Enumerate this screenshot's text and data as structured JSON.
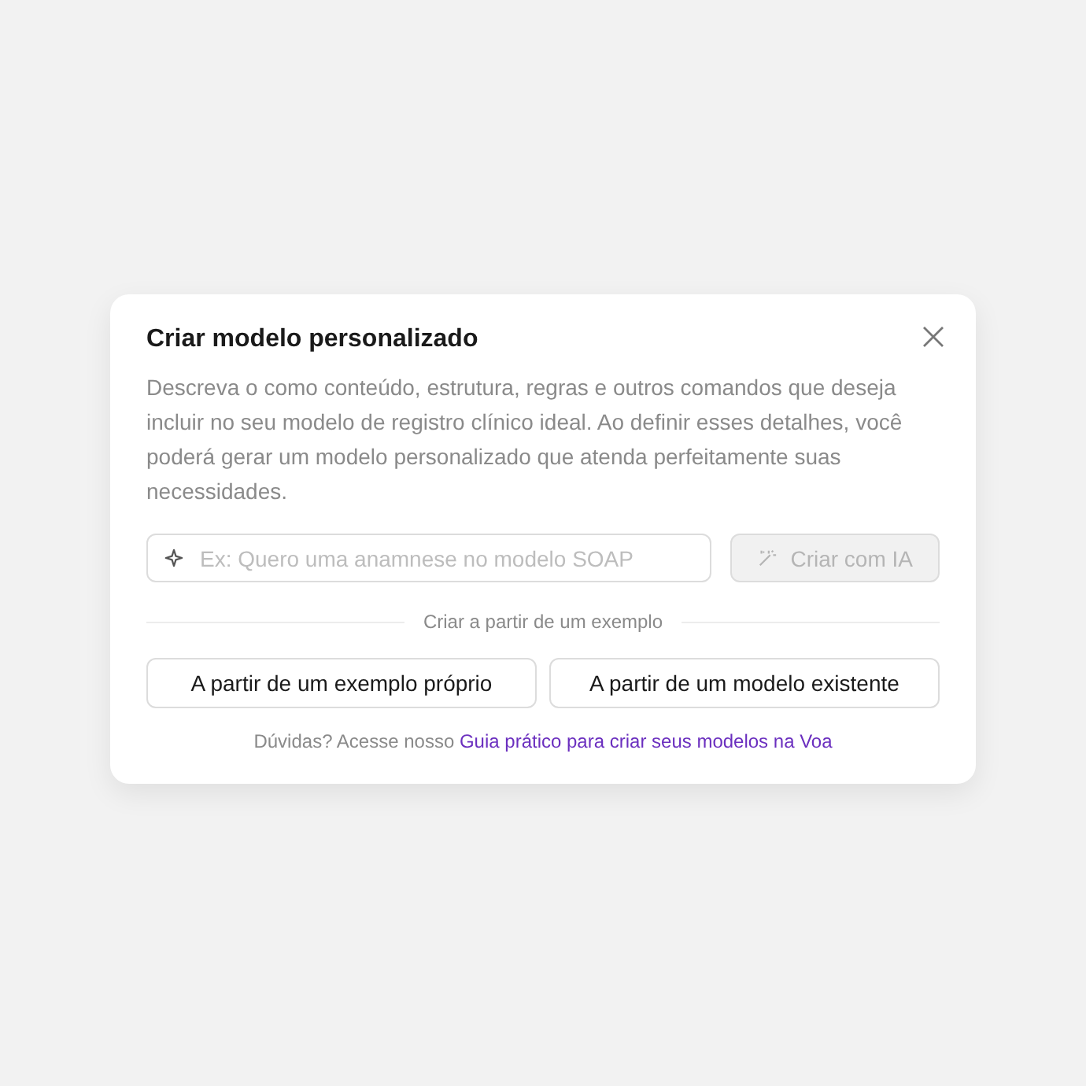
{
  "dialog": {
    "title": "Criar modelo personalizado",
    "description": "Descreva o como conteúdo, estrutura, regras e outros comandos que deseja incluir no seu modelo de registro clínico ideal. Ao definir esses detalhes, você poderá gerar um modelo personalizado que atenda perfeitamente suas necessidades.",
    "prompt_field": {
      "placeholder": "Ex: Quero uma anamnese no modelo SOAP"
    },
    "create_button": {
      "label": "Criar com IA",
      "disabled": true
    },
    "divider_label": "Criar a partir de um exemplo",
    "option_buttons": [
      "A partir de um exemplo próprio",
      "A partir de um modelo existente"
    ],
    "help_text": "Dúvidas? Acesse nosso",
    "help_link": "Guia prático para criar seus modelos na Voa"
  }
}
